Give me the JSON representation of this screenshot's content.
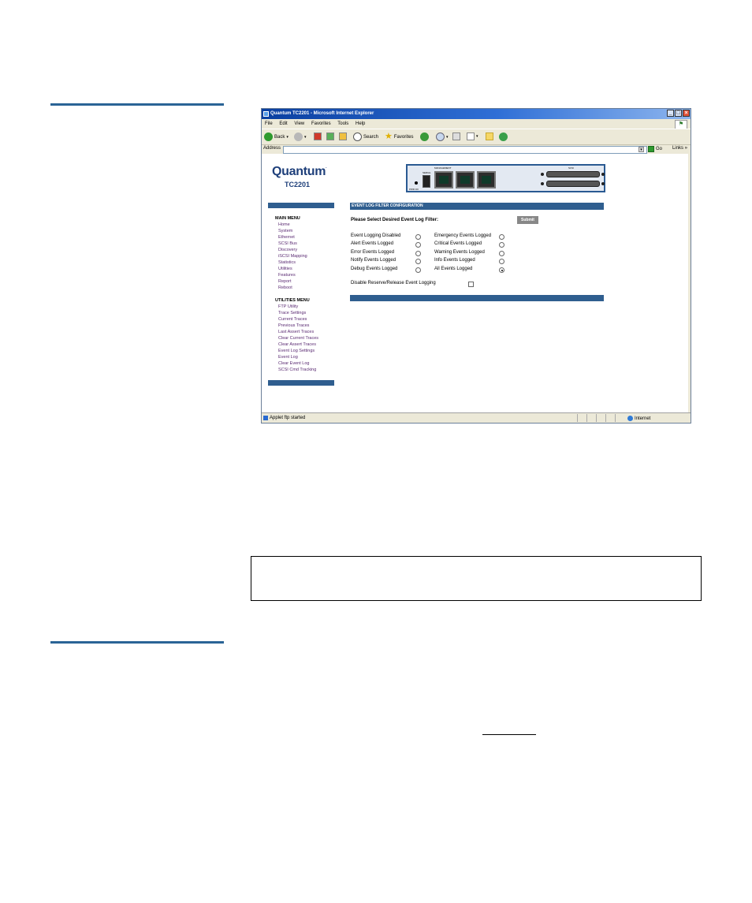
{
  "browser": {
    "title": "Quantum TC2201 - Microsoft Internet Explorer",
    "window_buttons": [
      "_",
      "□",
      "×"
    ],
    "menu": [
      "File",
      "Edit",
      "View",
      "Favorites",
      "Tools",
      "Help"
    ],
    "toolbar": {
      "back": "Back",
      "search": "Search",
      "favorites": "Favorites"
    },
    "address_label": "Address",
    "address_value": "",
    "go_label": "Go",
    "links_label": "Links",
    "links_chevron": "»",
    "status_text": "Applet ftp started",
    "zone_text": "Internet"
  },
  "logo": {
    "brand": "Quantum",
    "trademark": ".",
    "model": "TC2201"
  },
  "device_panel": {
    "labels": {
      "serial": "SERIAL",
      "management": "MANAGEMENT",
      "pwr": "PWR IOI",
      "scsi": "SCSI"
    }
  },
  "main_menu": {
    "heading": "MAIN MENU",
    "items": [
      "Home",
      "System",
      "Ethernet",
      "SCSI Bus",
      "Discovery",
      "iSCSI Mapping",
      "Statistics",
      "Utilities",
      "Features",
      "Report",
      "Reboot"
    ]
  },
  "utilities_menu": {
    "heading": "UTILITIES MENU",
    "items": [
      "FTP Utility",
      "Trace Settings",
      "Current Traces",
      "Previous Traces",
      "Last Assert Traces",
      "Clear Current Traces",
      "Clear Assert Traces",
      "Event Log Settings",
      "Event Log",
      "Clear Event Log",
      "SCSI Cmd Tracking"
    ]
  },
  "event_log": {
    "header": "EVENT LOG FILTER CONFIGURATION",
    "prompt": "Please Select Desired Event Log Filter:",
    "submit_label": "Submit",
    "left_options": [
      "Event Logging Disabled",
      "Alert Events Logged",
      "Error Events Logged",
      "Notify Events Logged",
      "Debug Events Logged"
    ],
    "right_options": [
      "Emergency Events Logged",
      "Critical Events Logged",
      "Warning Events Logged",
      "Info Events Logged",
      "All Events Logged"
    ],
    "selected": "All Events Logged",
    "reserve_release_label": "Disable Reserve/Release Event Logging",
    "reserve_release_checked": false
  },
  "colors": {
    "accent_rule": "#2a6496",
    "nav_bar": "#2f5e8f",
    "logo_text": "#1e3f7a",
    "link": "#5a2a72"
  }
}
